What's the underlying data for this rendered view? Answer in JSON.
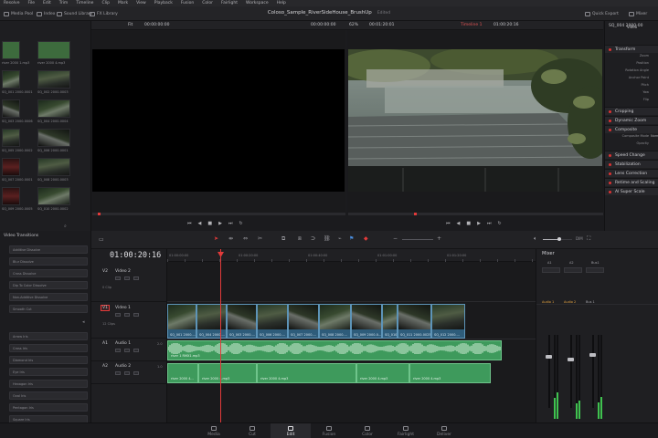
{
  "menu": [
    "Resolve",
    "File",
    "Edit",
    "Trim",
    "Timeline",
    "Clip",
    "Mark",
    "View",
    "Playback",
    "Fusion",
    "Color",
    "Fairlight",
    "Workspace",
    "Help"
  ],
  "toolbar": {
    "media_pool": "Media Pool",
    "index": "Index",
    "sound_library": "Sound Library",
    "fx_library": "FX Library",
    "quick_export": "Quick Export",
    "mixer": "Mixer",
    "project_title": "Coloso_Sample_RiverSideHouse_BrushUp",
    "project_status": "Edited"
  },
  "viewer_bar": {
    "fit": "Fit",
    "source_tc": "00:00:00:00",
    "source_duration": "00:00:00:00",
    "zoom": "62%",
    "program_duration": "00:01:20:01",
    "timeline_name": "Timeline 1",
    "program_tc": "01:00:20:16",
    "clip_name": "SQ_004 2000-00"
  },
  "media_pool": {
    "items": [
      {
        "label": "river 2000 1.mp3",
        "style": "thumb-wave"
      },
      {
        "label": "river 2000 4.mp3",
        "style": "thumb-wave"
      },
      {
        "label": "SQ_001 2000-0001.mp4",
        "style": "thumb-a"
      },
      {
        "label": "SQ_002 2000-0003.mp4",
        "style": "thumb-b"
      },
      {
        "label": "SQ_003 2000-0006.mp4",
        "style": "thumb-c"
      },
      {
        "label": "SQ_004 2000-0004.mp4",
        "style": "thumb-a"
      },
      {
        "label": "SQ_005 2000-0002.mp4",
        "style": "thumb-b"
      },
      {
        "label": "SQ_006 2000-0001.mp4",
        "style": "thumb-c"
      },
      {
        "label": "SQ_007 2000-0001.mp4",
        "style": "thumb-red"
      },
      {
        "label": "SQ_008 2000-0003.mp4",
        "style": "thumb-b"
      },
      {
        "label": "SQ_009 2000-0005.mp4",
        "style": "thumb-red"
      },
      {
        "label": "SQ_010 2000-0002.mp4",
        "style": "thumb-a"
      }
    ]
  },
  "inspector": {
    "tab": "Video",
    "sections": [
      "Transform",
      "Cropping",
      "Dynamic Zoom",
      "Composite",
      "Speed Change",
      "Stabilization",
      "Lens Correction",
      "Retime and Scaling",
      "AI Super Scale"
    ],
    "transform_rows": [
      "Zoom",
      "Position",
      "Rotation Angle",
      "Anchor Point",
      "Pitch",
      "Yaw",
      "Flip"
    ],
    "composite_rows": [
      "Composite Mode",
      "Opacity"
    ],
    "composite_value": "Normal"
  },
  "effects": {
    "category": "Video Transitions",
    "items_a": [
      "Additive Dissolve",
      "Blur Dissolve",
      "Cross Dissolve",
      "Dip To Color Dissolve",
      "Non-Additive Dissolve",
      "Smooth Cut"
    ],
    "items_b": [
      "Arrow Iris",
      "Cross Iris",
      "Diamond Iris",
      "Eye Iris",
      "Hexagon Iris",
      "Oval Iris",
      "Pentagon Iris",
      "Square Iris"
    ]
  },
  "timeline": {
    "timecode": "01:00:20:16",
    "ruler": [
      "01:00:00:00",
      "01:00:20:00",
      "01:00:40:00",
      "01:01:00:00",
      "01:01:20:00"
    ],
    "tracks": {
      "v2": {
        "id": "V2",
        "name": "Video 2",
        "clips": "0 Clip"
      },
      "v1": {
        "id": "V1",
        "name": "Video 1",
        "clips": "12 Clips"
      },
      "a1": {
        "id": "A1",
        "name": "Audio 1",
        "level": "2.0"
      },
      "a2": {
        "id": "A2",
        "name": "Audio 2",
        "level": "1.0"
      }
    },
    "video_clips": [
      "SQ_001 2000-...",
      "SQ_004 2000-...",
      "SQ_003 2000-...",
      "SQ_006 2000-...",
      "SQ_007 2000-...",
      "SQ_008 2000-...",
      "SQ_009 2000-0...",
      "SQ_010 2000-...",
      "SQ_011 2000-0025.mo...",
      "SQ_012 2000-..."
    ],
    "a1_clip": "river 1 RMX1.mp3",
    "a2_clips": [
      "river 2000 4...",
      "river 2000 4.mp3",
      "river 2000 4.mp3",
      "river 2000 4.mp3",
      "river 2000 4.mp3"
    ]
  },
  "mixer": {
    "title": "Mixer",
    "channels": [
      "A1",
      "A2",
      "Bus1"
    ],
    "strips": [
      "Audio 1",
      "Audio 2",
      "Bus 1"
    ],
    "meter_levels": [
      0.25,
      0.32,
      0.18,
      0.22,
      0.2,
      0.26
    ],
    "fader_levels": [
      0.7,
      0.66,
      0.72
    ]
  },
  "volume": {
    "level": 0.55,
    "readout": "DIM"
  },
  "pages": [
    "Media",
    "Cut",
    "Edit",
    "Fusion",
    "Color",
    "Fairlight",
    "Deliver"
  ],
  "active_page": "Edit",
  "colors": {
    "accent": "#e23a3a",
    "video_clip": "#2e5c7a",
    "audio_clip": "#3e9a5c"
  }
}
